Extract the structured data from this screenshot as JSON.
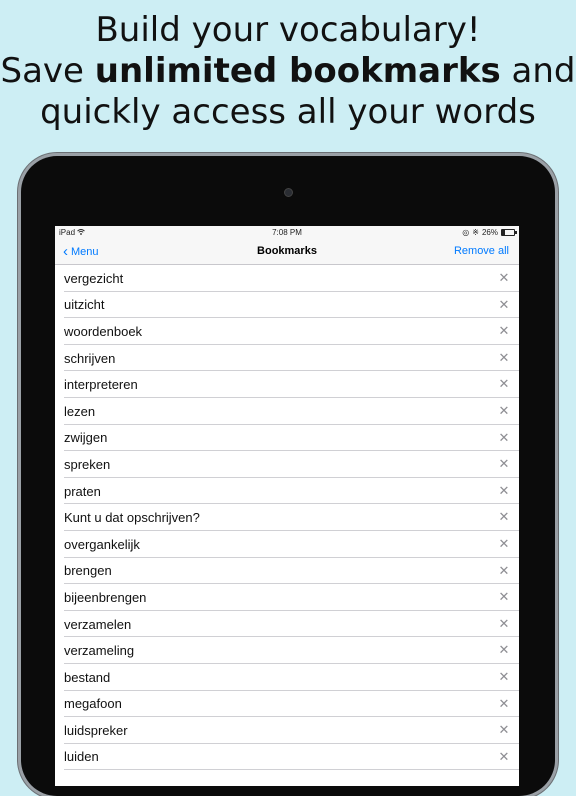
{
  "headline": {
    "line1": "Build your vocabulary!",
    "line2_pre": "Save ",
    "line2_bold": "unlimited bookmarks",
    "line2_post": " and",
    "line3": "quickly access all your words"
  },
  "statusbar": {
    "device": "iPad",
    "wifi_icon": "wifi-icon",
    "time": "7:08 PM",
    "battery_percent": "26%",
    "battery_level": 0.26
  },
  "navbar": {
    "back_label": "Menu",
    "title": "Bookmarks",
    "remove_all_label": "Remove all"
  },
  "bookmarks": [
    "vergezicht",
    "uitzicht",
    "woordenboek",
    "schrijven",
    "interpreteren",
    "lezen",
    "zwijgen",
    "spreken",
    "praten",
    "Kunt u dat opschrijven?",
    "overgankelijk",
    "brengen",
    "bijeenbrengen",
    "verzamelen",
    "verzameling",
    "bestand",
    "megafoon",
    "luidspreker",
    "luiden"
  ],
  "delete_icon": "close-icon",
  "colors": {
    "background": "#cdeef4",
    "accent": "#007aff"
  }
}
